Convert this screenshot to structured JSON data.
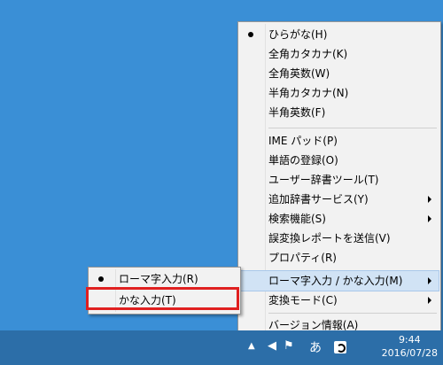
{
  "main_menu": {
    "items": [
      {
        "label": "ひらがな(H)",
        "checked": true
      },
      {
        "label": "全角カタカナ(K)"
      },
      {
        "label": "全角英数(W)"
      },
      {
        "label": "半角カタカナ(N)"
      },
      {
        "label": "半角英数(F)"
      },
      {
        "label": "IME パッド(P)"
      },
      {
        "label": "単語の登録(O)"
      },
      {
        "label": "ユーザー辞書ツール(T)"
      },
      {
        "label": "追加辞書サービス(Y)",
        "submenu": true
      },
      {
        "label": "検索機能(S)",
        "submenu": true
      },
      {
        "label": "誤変換レポートを送信(V)"
      },
      {
        "label": "プロパティ(R)"
      },
      {
        "label": "ローマ字入力 / かな入力(M)",
        "submenu": true,
        "highlighted": true
      },
      {
        "label": "変換モード(C)",
        "submenu": true
      },
      {
        "label": "バージョン情報(A)"
      }
    ]
  },
  "sub_menu": {
    "items": [
      {
        "label": "ローマ字入力(R)",
        "checked": true
      },
      {
        "label": "かな入力(T)"
      }
    ]
  },
  "taskbar": {
    "ime_mode": "あ",
    "time": "9:44",
    "date": "2016/07/28"
  },
  "colors": {
    "desktop": "#3a8fd6",
    "highlight_box": "#e02020"
  }
}
